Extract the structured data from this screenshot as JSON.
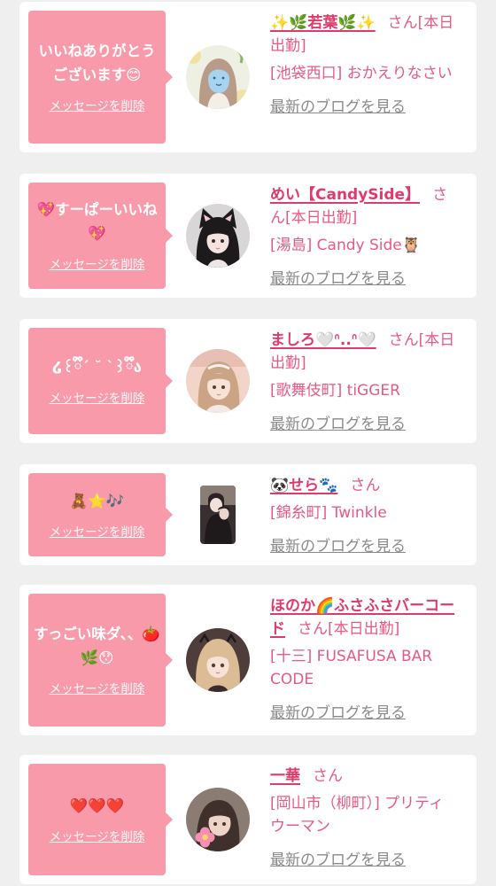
{
  "labels": {
    "delete": "メッセージを削除",
    "honorific": "さん",
    "blog": "最新のブログを見る"
  },
  "colors": {
    "background": "#efefef",
    "bubble": "#f99aab",
    "name": "#e03a6c",
    "text": "#e65a84",
    "link": "#8a8a8a"
  },
  "cards": [
    {
      "message": "いいねありがとうございます😊",
      "name": "✨🌿若葉🌿✨",
      "status": "[本日出勤]",
      "shop": "[池袋西口] おかえりなさい"
    },
    {
      "message": "💖すーぱーいいね💖",
      "name": "めい【CandySide】",
      "status": "[本日出勤]",
      "shop": "[湯島] Candy Side🦉"
    },
    {
      "message": "໒꒰ྀི´ ˘ `꒱ྀིა",
      "name": "ましろ🤍ᐢ..ᐢ🤍",
      "status": "[本日出勤]",
      "shop": "[歌舞伎町] tiGGER"
    },
    {
      "message": "🧸⭐🎶",
      "name": "🐼せら🐾",
      "shop": "[錦糸町] Twinkle"
    },
    {
      "message": "すっごい味ダ、、🍅🌿😯",
      "name": "ほのか🌈ふさふさバーコード",
      "status": "[本日出勤]",
      "shop": "[十三] FUSAFUSA BAR CODE"
    },
    {
      "message": "❤️❤️❤️",
      "name": "一華",
      "shop": "[岡山市（柳町）] プリティウーマン"
    }
  ]
}
